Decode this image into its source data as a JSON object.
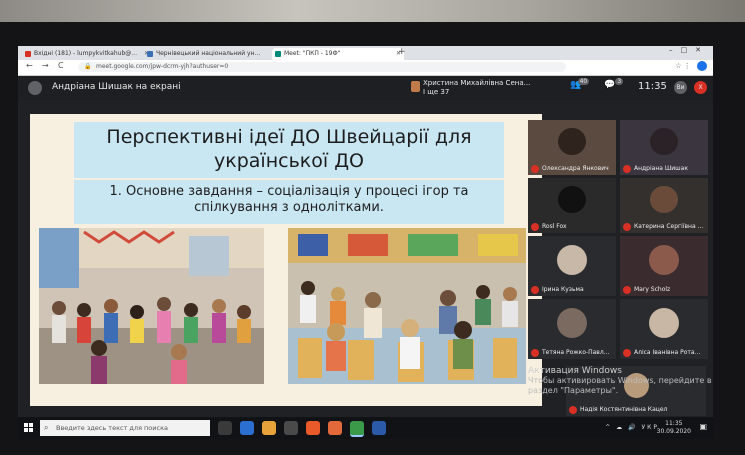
{
  "browser": {
    "tabs": [
      {
        "label": "Вхідні (181) - lumpykvitkahub@...",
        "color": "#d93025"
      },
      {
        "label": "Чернівецький національний ун...",
        "color": "#3b6fb6"
      },
      {
        "label": "Meet: \"ПКП - 19Ф\"",
        "color": "#00897b"
      }
    ],
    "new_tab": "+",
    "url": "meet.google.com/jpw-dcrm-yjh?authuser=0",
    "nav_back": "←",
    "nav_forward": "→",
    "nav_reload": "C",
    "tools": "☆  ⋮"
  },
  "meet": {
    "presenter_label": "Андріана Шишак на екрані",
    "pinned_name": "Христина Михайлівна Сена...",
    "pinned_sub": "І ще 37",
    "people_icon": "👥",
    "people_count": "40",
    "chat_icon": "💬",
    "chat_count": "3",
    "time": "11:35",
    "you_label": "Ви",
    "exit_label": "X"
  },
  "slide": {
    "title": "Перспективні ідеї ДО Швейцарії для української ДО",
    "subtitle": "1. Основне завдання – соціалізація у процесі ігор та спілкування з однолітками."
  },
  "participants": [
    {
      "name": "Олександра Янкович",
      "bg": "#5a4a3f",
      "av": "#2e241d"
    },
    {
      "name": "Андріана Шишак",
      "bg": "#3b3540",
      "av": "#2a2226"
    },
    {
      "name": "Rosl Fox",
      "bg": "#2a2a2a",
      "av": "#111111"
    },
    {
      "name": "Катерина Сергіївна ...",
      "bg": "#33302e",
      "av": "#6a4b3a"
    },
    {
      "name": "Ірина Кузьма",
      "bg": "#2a2b2e",
      "av": "#c7b8a8"
    },
    {
      "name": "Mary Scholz",
      "bg": "#3a2b2e",
      "av": "#8c5a4a"
    },
    {
      "name": "Тетяна Рожко-Павл...",
      "bg": "#2a2b2e",
      "av": "#7a6a60"
    },
    {
      "name": "Аліса Іванівна Рота...",
      "bg": "#2a2b2e",
      "av": "#c9b7a6"
    },
    {
      "name": "Надія Костянтинівна Кацел",
      "bg": "#2a2b2e",
      "av": "#b89b7a"
    }
  ],
  "activation": {
    "title": "Активация Windows",
    "line1": "Чтобы активировать Windows, перейдите в",
    "line2": "раздел \"Параметры\"."
  },
  "taskbar": {
    "search_placeholder": "Введите здесь текст для поиска",
    "tray": "^ ☁ 🔊 УКР",
    "clock_time": "11:35",
    "clock_date": "30.09.2020",
    "notif": "▣"
  }
}
